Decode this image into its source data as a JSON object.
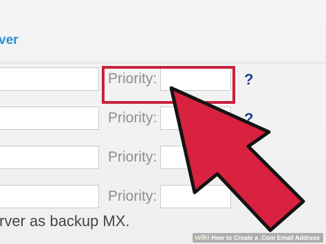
{
  "section": {
    "title": "ver"
  },
  "rows": [
    {
      "priority_label": "Priority:",
      "help": "?",
      "host_value": "",
      "priority_value": ""
    },
    {
      "priority_label": "Priority:",
      "help": "?",
      "host_value": "",
      "priority_value": ""
    },
    {
      "priority_label": "Priority:",
      "help": "?",
      "host_value": "",
      "priority_value": ""
    },
    {
      "priority_label": "Priority:",
      "help": "?",
      "host_value": "",
      "priority_value": ""
    }
  ],
  "footer": {
    "text": "rver as backup MX."
  },
  "annotation": {
    "highlight_color": "#c9203a",
    "arrow_color": "#d8223f",
    "arrow_target": "first-priority-input"
  },
  "watermark": {
    "logo": "wiki",
    "text": "How to Create a .Com Email Address"
  },
  "colors": {
    "section_title": "#2a8fd0",
    "label": "#8e8e8e",
    "help_link": "#1c3f8f",
    "background": "#f2f2f2"
  }
}
